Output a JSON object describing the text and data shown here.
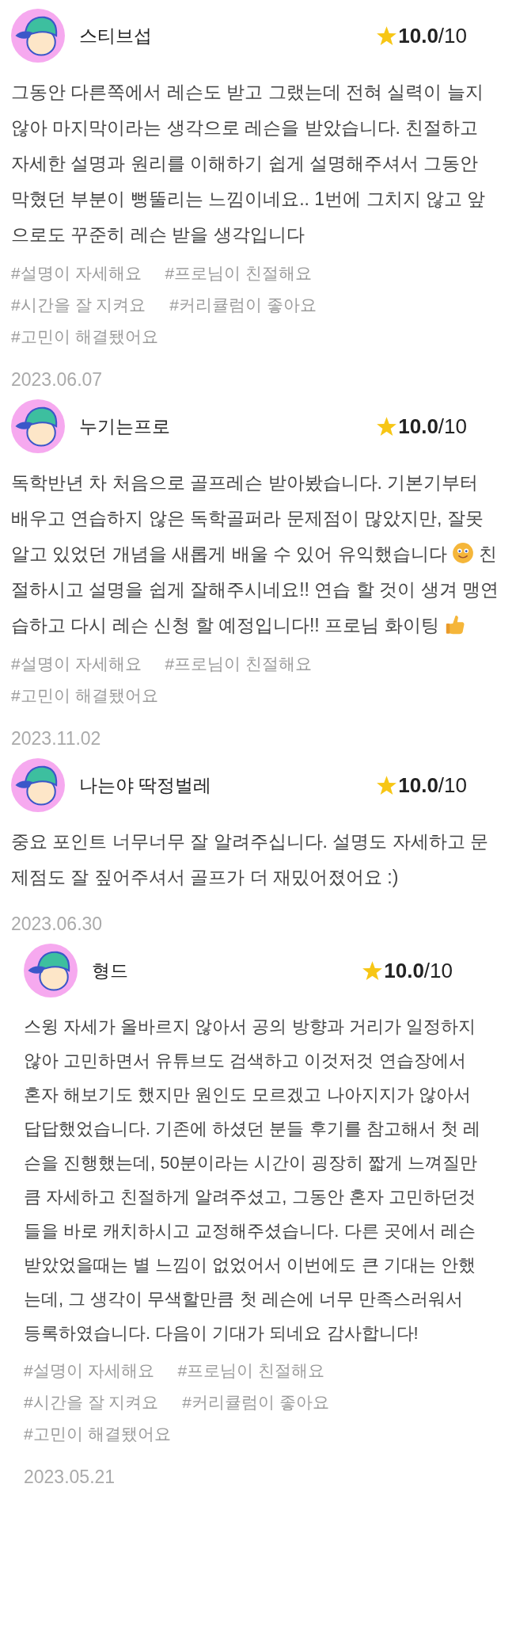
{
  "reviews": [
    {
      "name": "스티브섭",
      "score": "10.0",
      "scale": "/10",
      "body": [
        {
          "kind": "text",
          "text": "그동안 다른쪽에서 레슨도 받고 그랬는데 전혀 실력이 늘지 않아 마지막이라는 생각으로 레슨을 받았습니다. 친절하고 자세한 설명과 원리를 이해하기 쉽게 설명해주셔서 그동안 막혔던 부분이 뻥뚤리는 느낌이네요.. 1번에 그치지 않고 앞으로도 꾸준히 레슨 받을 생각입니다"
        }
      ],
      "tags": [
        "#설명이 자세해요",
        "#프로님이 친절해요",
        "#시간을 잘 지켜요",
        "#커리큘럼이 좋아요",
        "#고민이 해결됐어요"
      ],
      "date": "2023.06.07"
    },
    {
      "name": "누기는프로",
      "score": "10.0",
      "scale": "/10",
      "body": [
        {
          "kind": "text",
          "text": "독학반년 차 처음으로 골프레슨 받아봤습니다. 기본기부터 배우고 연습하지 않은 독학골퍼라 문제점이 많았지만, 잘못알고 있었던 개념을 새롭게 배울 수 있어 유익했습니다"
        },
        {
          "kind": "smiley"
        },
        {
          "kind": "text",
          "text": "친절하시고 설명을 쉽게 잘해주시네요!! 연습 할 것이 생겨 맹연습하고 다시 레슨 신청 할 예정입니다!! 프로님 화이팅"
        },
        {
          "kind": "thumbs-up"
        }
      ],
      "tags": [
        "#설명이 자세해요",
        "#프로님이 친절해요",
        "#고민이 해결됐어요"
      ],
      "date": "2023.11.02"
    },
    {
      "name": "나는야 딱정벌레",
      "score": "10.0",
      "scale": "/10",
      "body": [
        {
          "kind": "text",
          "text": "중요 포인트 너무너무 잘 알려주십니다. 설명도 자세하고 문제점도 잘 짚어주셔서 골프가 더 재밌어졌어요 :)"
        }
      ],
      "date": "2023.06.30"
    },
    {
      "name": "형드",
      "score": "10.0",
      "scale": "/10",
      "body": [
        {
          "kind": "text",
          "text": "스윙 자세가 올바르지 않아서 공의 방향과 거리가 일정하지 않아 고민하면서 유튜브도 검색하고 이것저것 연습장에서 혼자 해보기도 했지만 원인도 모르겠고 나아지지가 않아서 답답했었습니다. 기존에 하셨던 분들 후기를 참고해서 첫 레슨을 진행했는데, 50분이라는 시간이 굉장히 짧게 느껴질만큼 자세하고 친절하게 알려주셨고, 그동안 혼자 고민하던것들을 바로 캐치하시고 교정해주셨습니다. 다른 곳에서 레슨 받았었을때는 별 느낌이 없었어서 이번에도 큰 기대는 안했는데, 그 생각이 무색할만큼 첫 레슨에 너무 만족스러워서 등록하였습니다. 다음이 기대가 되네요 감사합니다!"
        }
      ],
      "tags": [
        "#설명이 자세해요",
        "#프로님이 친절해요",
        "#시간을 잘 지켜요",
        "#커리큘럼이 좋아요",
        "#고민이 해결됐어요"
      ],
      "date": "2023.05.21"
    }
  ]
}
